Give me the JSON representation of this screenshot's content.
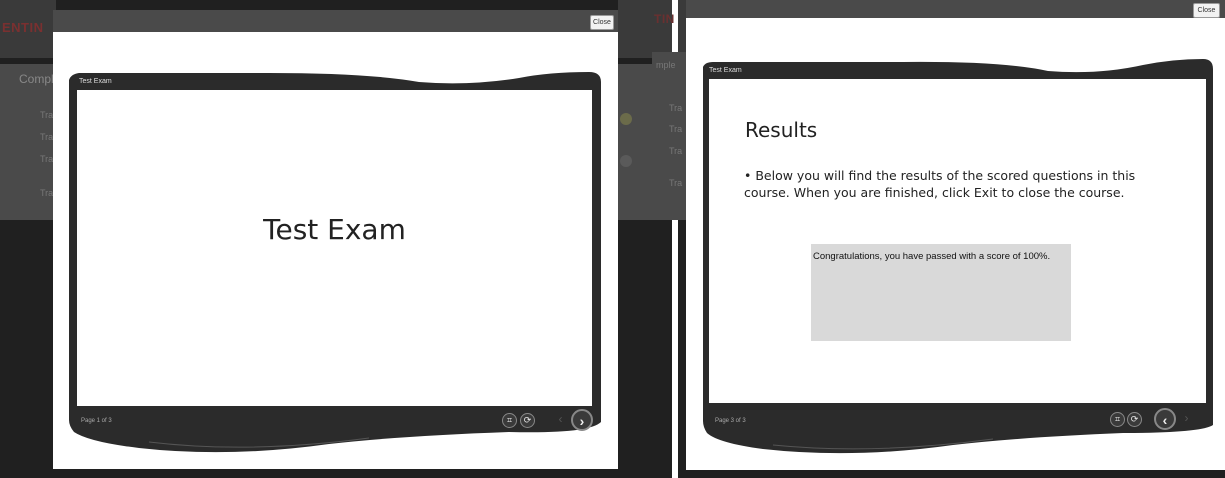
{
  "background_app": {
    "logo_left": "ENTIN",
    "logo_right": "TIN",
    "section_left": "Comple",
    "section_right": "mple",
    "row_label_left": "Tra",
    "row_label_left_short": "Tra",
    "row_label_right": "Tra"
  },
  "left_panel": {
    "close_label": "Close",
    "player_title": "Test Exam",
    "slide_title": "Test Exam",
    "page_label": "Page 1 of 3",
    "controls": {
      "fit": "⌗",
      "refresh": "⟳",
      "prev": "‹",
      "next": "›"
    }
  },
  "right_panel": {
    "close_label": "Close",
    "player_title": "Test Exam",
    "results_title": "Results",
    "bullet_text": "• Below you will find the results of the scored questions in this course. When you are finished, click Exit to close the course.",
    "score_message": "Congratulations, you have passed with a score of 100%.",
    "page_label": "Page 3 of 3",
    "controls": {
      "fit": "⌗",
      "refresh": "⟳",
      "prev": "‹",
      "next": "›"
    }
  },
  "colors": {
    "backdrop": "#202020",
    "player_frame": "#2b2b2b",
    "score_box": "#d9d9d9"
  }
}
